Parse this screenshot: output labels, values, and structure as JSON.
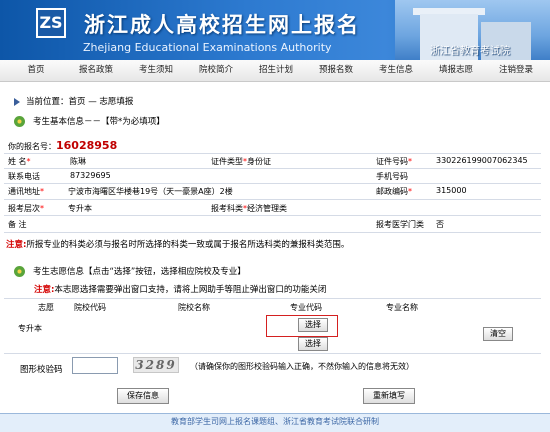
{
  "header": {
    "logo_text": "ZS",
    "title": "浙江成人高校招生网上报名",
    "subtitle": "Zhejiang Educational Examinations Authority",
    "org": "浙江省教育考试院"
  },
  "nav": [
    "首页",
    "报名政策",
    "考生须知",
    "院校简介",
    "招生计划",
    "预报名数",
    "考生信息",
    "填报志愿",
    "注销登录"
  ],
  "breadcrumb": "当前位置：首页 — 志愿填报",
  "basic_section_title": "考生基本信息－－【带*为必填项】",
  "registration": {
    "label": "你的报名号：",
    "value": "16028958"
  },
  "fields": {
    "name_label": "姓 名",
    "name_value": "陈琳",
    "id_type_label": "证件类型",
    "id_type_value": "身份证",
    "id_no_label": "证件号码",
    "id_no_value": "330226199007062345",
    "phone_label": "联系电话",
    "phone_value": "87329695",
    "mobile_label": "手机号码",
    "mobile_value": "",
    "address_label": "通讯地址",
    "address_value": "宁波市海曙区华楼巷19号（天一豪景A座）2楼",
    "postcode_label": "邮政编码",
    "postcode_value": "315000",
    "level_label": "报考层次",
    "level_value": "专升本",
    "subject_label": "报考科类",
    "subject_value": "经济管理类",
    "remark_label": "备 注",
    "remark_value": "",
    "medical_label": "报考医学门类",
    "medical_value": "否"
  },
  "note1_bold": "注意:",
  "note1_text": "所报专业的科类必须与报名时所选择的科类一致或属于报名所选科类的兼报科类范围。",
  "wish_section_title": "考生志愿信息【点击“选择”按钮，选择相应院校及专业】",
  "note2_bold": "注意:",
  "note2_text": "本志愿选择需要弹出窗口支持，请将上网助手等阻止弹出窗口的功能关闭",
  "wish_table": {
    "headers": [
      "志愿",
      "院校代码",
      "院校名称",
      "专业代码",
      "专业名称"
    ],
    "row_label": "专升本",
    "select_label": "选择",
    "clear_label": "清空"
  },
  "captcha": {
    "label": "图形校验码",
    "input_value": "",
    "image_text": "3289",
    "hint": "（请确保你的图形校验码输入正确，不然你输入的信息将无效）"
  },
  "buttons": {
    "save": "保存信息",
    "reset": "重新填写"
  },
  "footer": "教育部学生司网上报名课题组、浙江省教育考试院联合研制",
  "colors": {
    "banner": "#2d7ad0",
    "accent_red": "#d40000",
    "select_highlight": "#d42020"
  }
}
